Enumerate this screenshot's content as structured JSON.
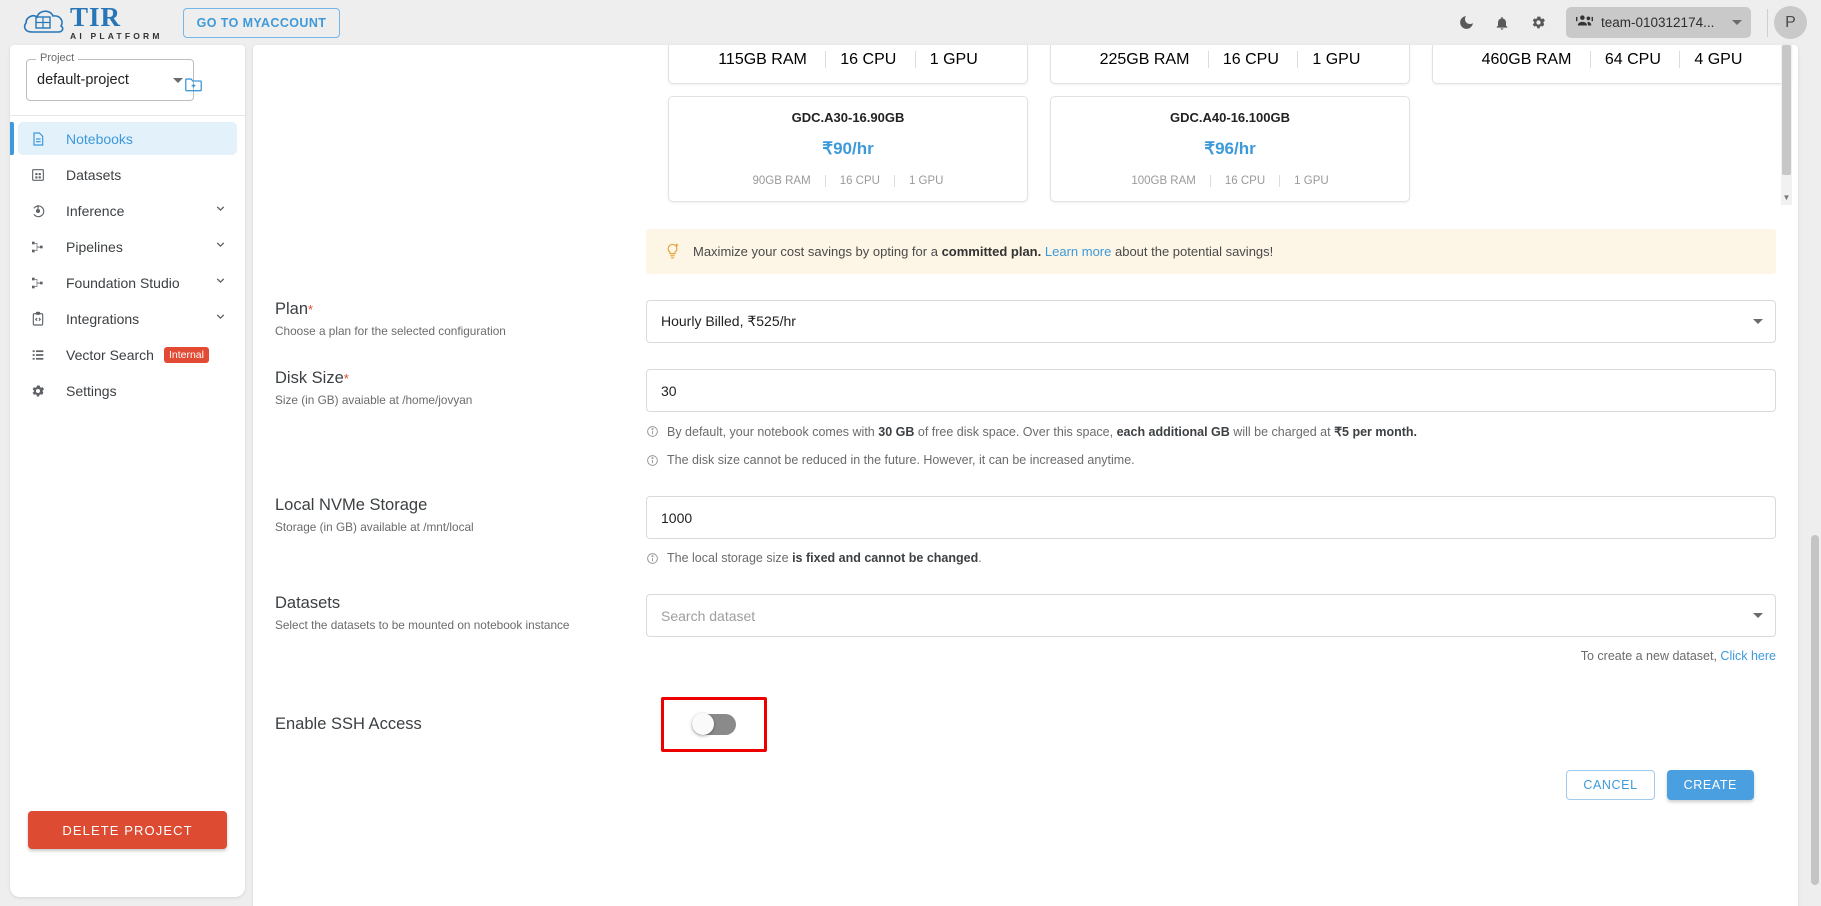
{
  "header": {
    "logo_title": "TIR",
    "logo_subtitle": "AI PLATFORM",
    "myaccount_button": "GO TO MYACCOUNT",
    "dark_mode_icon": "moon-icon",
    "notifications_icon": "bell-icon",
    "settings_icon": "gear-icon",
    "team_icon": "people-group-icon",
    "team_name": "team-010312174...",
    "avatar_initial": "P"
  },
  "sidebar": {
    "project_legend": "Project",
    "project_value": "default-project",
    "new_project_icon": "folder-add-icon",
    "items": [
      {
        "label": "Notebooks",
        "icon": "document-icon",
        "active": true,
        "expandable": false,
        "badge": ""
      },
      {
        "label": "Datasets",
        "icon": "grid-icon",
        "active": false,
        "expandable": false,
        "badge": ""
      },
      {
        "label": "Inference",
        "icon": "inference-icon",
        "active": false,
        "expandable": true,
        "badge": ""
      },
      {
        "label": "Pipelines",
        "icon": "pipeline-icon",
        "active": false,
        "expandable": true,
        "badge": ""
      },
      {
        "label": "Foundation Studio",
        "icon": "pipeline-icon",
        "active": false,
        "expandable": true,
        "badge": ""
      },
      {
        "label": "Integrations",
        "icon": "code-clipboard-icon",
        "active": false,
        "expandable": true,
        "badge": ""
      },
      {
        "label": "Vector Search",
        "icon": "list-icon",
        "active": false,
        "expandable": false,
        "badge": "Internal"
      },
      {
        "label": "Settings",
        "icon": "gear-icon",
        "active": false,
        "expandable": false,
        "badge": ""
      }
    ],
    "delete_project_button": "DELETE PROJECT"
  },
  "plan_cards": {
    "clipped_row": [
      {
        "specs": [
          "115GB RAM",
          "16 CPU",
          "1 GPU"
        ]
      },
      {
        "specs": [
          "225GB RAM",
          "16 CPU",
          "1 GPU"
        ]
      },
      {
        "specs": [
          "460GB RAM",
          "64 CPU",
          "4 GPU"
        ]
      }
    ],
    "visible_row": [
      {
        "title": "GDC.A30-16.90GB",
        "price": "₹90/hr",
        "specs": [
          "90GB RAM",
          "16 CPU",
          "1 GPU"
        ]
      },
      {
        "title": "GDC.A40-16.100GB",
        "price": "₹96/hr",
        "specs": [
          "100GB RAM",
          "16 CPU",
          "1 GPU"
        ]
      }
    ]
  },
  "banner": {
    "icon": "lightbulb-icon",
    "text_before": "Maximize your cost savings by opting for a",
    "bold": "committed plan.",
    "link": "Learn more",
    "text_after": "about the potential savings!"
  },
  "form": {
    "plan": {
      "label": "Plan",
      "required_marker": "*",
      "sublabel": "Choose a plan for the selected configuration",
      "value": "Hourly Billed, ₹525/hr"
    },
    "disk_size": {
      "label": "Disk Size",
      "required_marker": "*",
      "sublabel": "Size (in GB) avaiable at /home/jovyan",
      "value": "30",
      "note1_a": "By default, your notebook comes with",
      "note1_b": "30 GB",
      "note1_c": "of free disk space. Over this space,",
      "note1_d": "each additional GB",
      "note1_e": "will be charged at",
      "note1_f": "₹5 per month.",
      "note2": "The disk size cannot be reduced in the future. However, it can be increased anytime."
    },
    "local_nvme": {
      "label": "Local NVMe Storage",
      "sublabel": "Storage (in GB) available at /mnt/local",
      "value": "1000",
      "note_a": "The local storage size",
      "note_b": "is fixed and cannot be changed",
      "note_c": "."
    },
    "datasets": {
      "label": "Datasets",
      "sublabel": "Select the datasets to be mounted on notebook instance",
      "placeholder": "Search dataset",
      "helper_text": "To create a new dataset,",
      "helper_link": "Click here"
    },
    "ssh": {
      "label": "Enable SSH Access",
      "enabled": false,
      "highlight_color": "#ee0000"
    }
  },
  "footer": {
    "cancel_label": "CANCEL",
    "create_label": "CREATE"
  },
  "colors": {
    "accent": "#3d9ada",
    "danger": "#dd4b32",
    "banner_bg": "#fdf5e6",
    "highlight": "#ee0000"
  }
}
